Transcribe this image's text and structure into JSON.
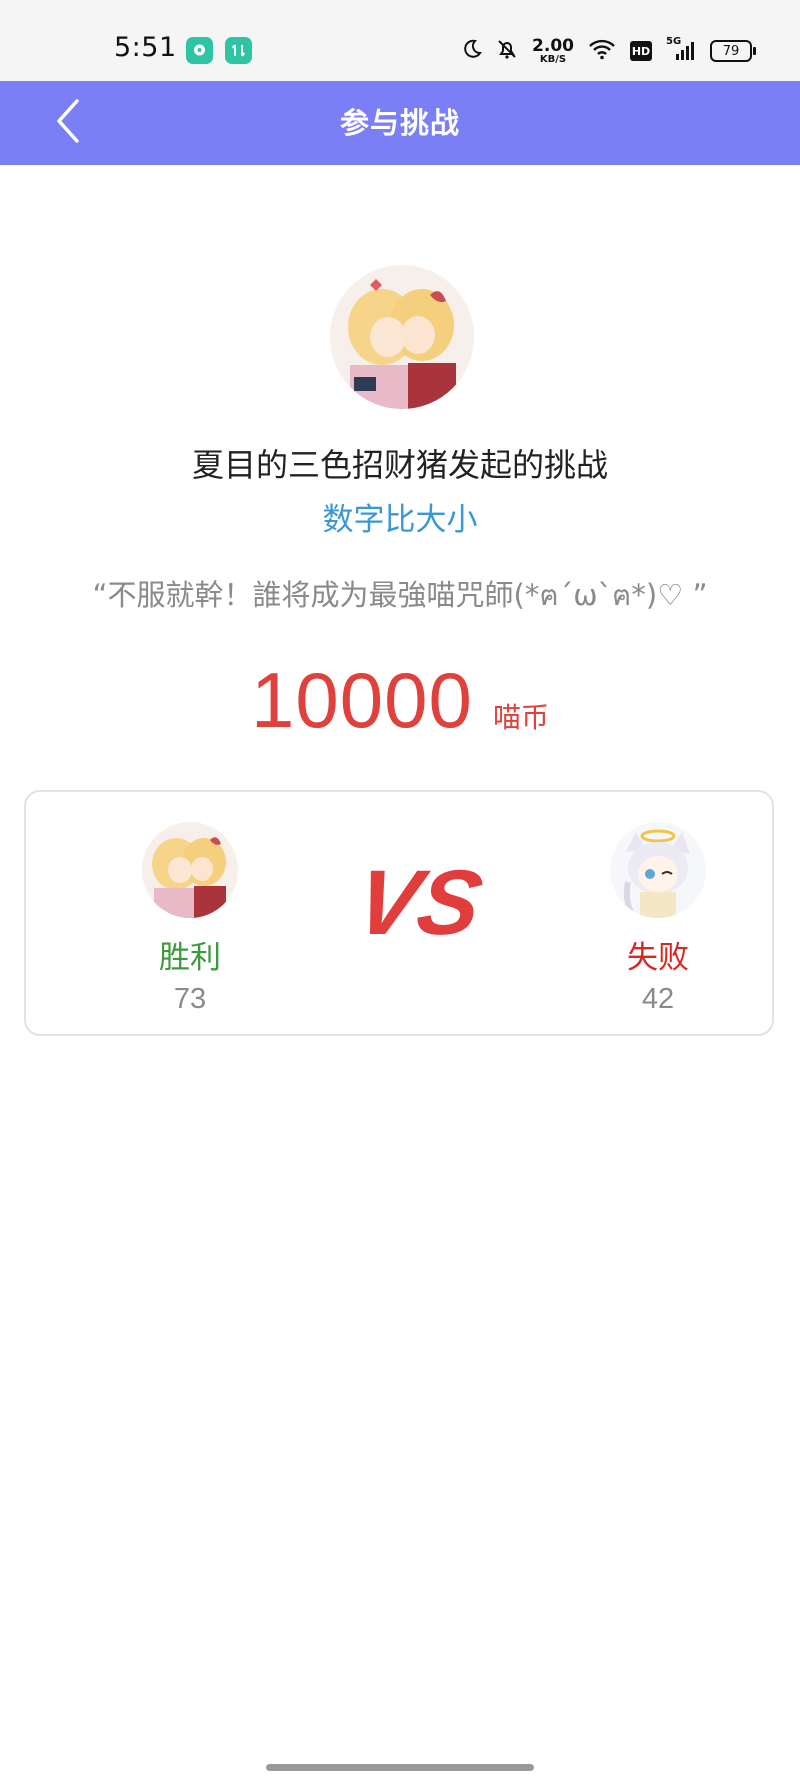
{
  "status_bar": {
    "time": "5:51",
    "app_badges": [
      "chat-bubble-icon",
      "network-arrows-icon"
    ],
    "net_speed_value": "2.00",
    "net_speed_unit": "KB/S",
    "hd_label": "HD",
    "network_type": "5G",
    "battery_level": "79",
    "icons": [
      "moon-icon",
      "bell-off-icon",
      "wifi-icon",
      "signal-icon",
      "battery-icon"
    ]
  },
  "navbar": {
    "title": "参与挑战",
    "back_icon": "chevron-left-icon",
    "color": "#7b7ff5"
  },
  "challenge": {
    "title": "夏目的三色招财猪发起的挑战",
    "game_name": "数字比大小",
    "slogan": "“不服就幹！誰将成为最強喵咒師(*ฅ´ω`ฅ*)♡ ”",
    "stake_amount": "10000",
    "stake_unit": "喵币"
  },
  "matchup": {
    "vs_label": "VS",
    "left": {
      "result": "胜利",
      "score": "73"
    },
    "right": {
      "result": "失败",
      "score": "42"
    }
  },
  "colors": {
    "accent": "#7b7ff5",
    "link": "#3a97d6",
    "stake": "#e0413c",
    "win": "#3d9a3c",
    "lose": "#d9271f"
  }
}
